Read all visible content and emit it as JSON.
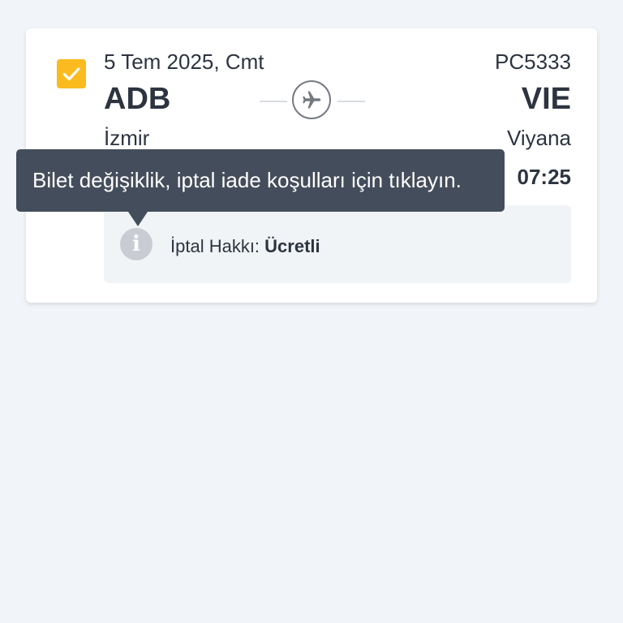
{
  "flight": {
    "date": "5 Tem 2025, Cmt",
    "flight_number": "PC5333",
    "origin_code": "ADB",
    "origin_city": "İzmir",
    "destination_code": "VIE",
    "destination_city": "Viyana",
    "arrival_time": "07:25",
    "selected": true
  },
  "refund": {
    "label": "İptal Hakkı:",
    "value": "Ücretli"
  },
  "tooltip": {
    "text": "Bilet değişiklik, iptal iade koşulları için tıklayın."
  },
  "colors": {
    "accent": "#fbbb1e",
    "tooltip_bg": "#444d5b",
    "page_bg": "#f1f5f9",
    "text": "#2d3440"
  },
  "icons": {
    "checkbox": "check-icon",
    "plane": "plane-icon",
    "info": "info-icon"
  }
}
